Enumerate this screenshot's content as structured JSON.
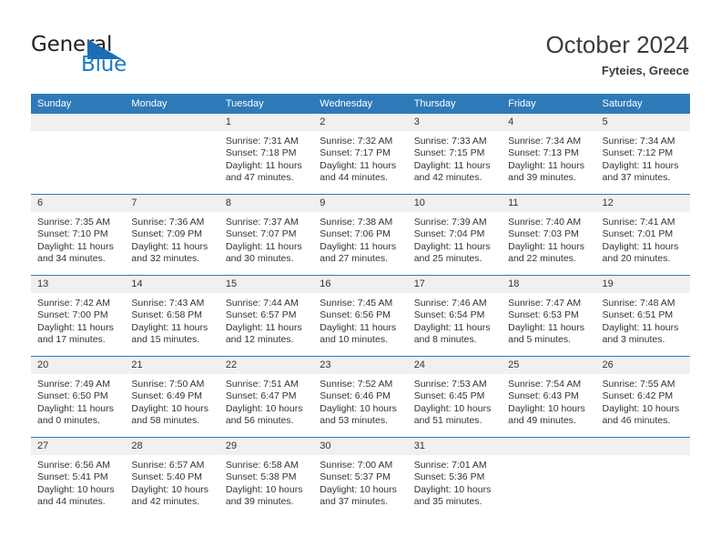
{
  "brand": {
    "name_part1": "General",
    "name_part2": "Blue",
    "logo_icon": "blue-triangle-logo",
    "color_dark": "#231f20",
    "color_blue": "#1b7ac4"
  },
  "header": {
    "title": "October 2024",
    "subtitle": "Fyteies, Greece"
  },
  "theme": {
    "header_row_bg": "#2e7ab8",
    "daynum_bg": "#f0f0f0",
    "grid_line": "#2e7ab8",
    "text": "#333333"
  },
  "calendar": {
    "weekdays": [
      "Sunday",
      "Monday",
      "Tuesday",
      "Wednesday",
      "Thursday",
      "Friday",
      "Saturday"
    ],
    "weeks": [
      [
        {
          "day": "",
          "sunrise": "",
          "sunset": "",
          "daylight_line1": "",
          "daylight_line2": ""
        },
        {
          "day": "",
          "sunrise": "",
          "sunset": "",
          "daylight_line1": "",
          "daylight_line2": ""
        },
        {
          "day": "1",
          "sunrise": "Sunrise: 7:31 AM",
          "sunset": "Sunset: 7:18 PM",
          "daylight_line1": "Daylight: 11 hours",
          "daylight_line2": "and 47 minutes."
        },
        {
          "day": "2",
          "sunrise": "Sunrise: 7:32 AM",
          "sunset": "Sunset: 7:17 PM",
          "daylight_line1": "Daylight: 11 hours",
          "daylight_line2": "and 44 minutes."
        },
        {
          "day": "3",
          "sunrise": "Sunrise: 7:33 AM",
          "sunset": "Sunset: 7:15 PM",
          "daylight_line1": "Daylight: 11 hours",
          "daylight_line2": "and 42 minutes."
        },
        {
          "day": "4",
          "sunrise": "Sunrise: 7:34 AM",
          "sunset": "Sunset: 7:13 PM",
          "daylight_line1": "Daylight: 11 hours",
          "daylight_line2": "and 39 minutes."
        },
        {
          "day": "5",
          "sunrise": "Sunrise: 7:34 AM",
          "sunset": "Sunset: 7:12 PM",
          "daylight_line1": "Daylight: 11 hours",
          "daylight_line2": "and 37 minutes."
        }
      ],
      [
        {
          "day": "6",
          "sunrise": "Sunrise: 7:35 AM",
          "sunset": "Sunset: 7:10 PM",
          "daylight_line1": "Daylight: 11 hours",
          "daylight_line2": "and 34 minutes."
        },
        {
          "day": "7",
          "sunrise": "Sunrise: 7:36 AM",
          "sunset": "Sunset: 7:09 PM",
          "daylight_line1": "Daylight: 11 hours",
          "daylight_line2": "and 32 minutes."
        },
        {
          "day": "8",
          "sunrise": "Sunrise: 7:37 AM",
          "sunset": "Sunset: 7:07 PM",
          "daylight_line1": "Daylight: 11 hours",
          "daylight_line2": "and 30 minutes."
        },
        {
          "day": "9",
          "sunrise": "Sunrise: 7:38 AM",
          "sunset": "Sunset: 7:06 PM",
          "daylight_line1": "Daylight: 11 hours",
          "daylight_line2": "and 27 minutes."
        },
        {
          "day": "10",
          "sunrise": "Sunrise: 7:39 AM",
          "sunset": "Sunset: 7:04 PM",
          "daylight_line1": "Daylight: 11 hours",
          "daylight_line2": "and 25 minutes."
        },
        {
          "day": "11",
          "sunrise": "Sunrise: 7:40 AM",
          "sunset": "Sunset: 7:03 PM",
          "daylight_line1": "Daylight: 11 hours",
          "daylight_line2": "and 22 minutes."
        },
        {
          "day": "12",
          "sunrise": "Sunrise: 7:41 AM",
          "sunset": "Sunset: 7:01 PM",
          "daylight_line1": "Daylight: 11 hours",
          "daylight_line2": "and 20 minutes."
        }
      ],
      [
        {
          "day": "13",
          "sunrise": "Sunrise: 7:42 AM",
          "sunset": "Sunset: 7:00 PM",
          "daylight_line1": "Daylight: 11 hours",
          "daylight_line2": "and 17 minutes."
        },
        {
          "day": "14",
          "sunrise": "Sunrise: 7:43 AM",
          "sunset": "Sunset: 6:58 PM",
          "daylight_line1": "Daylight: 11 hours",
          "daylight_line2": "and 15 minutes."
        },
        {
          "day": "15",
          "sunrise": "Sunrise: 7:44 AM",
          "sunset": "Sunset: 6:57 PM",
          "daylight_line1": "Daylight: 11 hours",
          "daylight_line2": "and 12 minutes."
        },
        {
          "day": "16",
          "sunrise": "Sunrise: 7:45 AM",
          "sunset": "Sunset: 6:56 PM",
          "daylight_line1": "Daylight: 11 hours",
          "daylight_line2": "and 10 minutes."
        },
        {
          "day": "17",
          "sunrise": "Sunrise: 7:46 AM",
          "sunset": "Sunset: 6:54 PM",
          "daylight_line1": "Daylight: 11 hours",
          "daylight_line2": "and 8 minutes."
        },
        {
          "day": "18",
          "sunrise": "Sunrise: 7:47 AM",
          "sunset": "Sunset: 6:53 PM",
          "daylight_line1": "Daylight: 11 hours",
          "daylight_line2": "and 5 minutes."
        },
        {
          "day": "19",
          "sunrise": "Sunrise: 7:48 AM",
          "sunset": "Sunset: 6:51 PM",
          "daylight_line1": "Daylight: 11 hours",
          "daylight_line2": "and 3 minutes."
        }
      ],
      [
        {
          "day": "20",
          "sunrise": "Sunrise: 7:49 AM",
          "sunset": "Sunset: 6:50 PM",
          "daylight_line1": "Daylight: 11 hours",
          "daylight_line2": "and 0 minutes."
        },
        {
          "day": "21",
          "sunrise": "Sunrise: 7:50 AM",
          "sunset": "Sunset: 6:49 PM",
          "daylight_line1": "Daylight: 10 hours",
          "daylight_line2": "and 58 minutes."
        },
        {
          "day": "22",
          "sunrise": "Sunrise: 7:51 AM",
          "sunset": "Sunset: 6:47 PM",
          "daylight_line1": "Daylight: 10 hours",
          "daylight_line2": "and 56 minutes."
        },
        {
          "day": "23",
          "sunrise": "Sunrise: 7:52 AM",
          "sunset": "Sunset: 6:46 PM",
          "daylight_line1": "Daylight: 10 hours",
          "daylight_line2": "and 53 minutes."
        },
        {
          "day": "24",
          "sunrise": "Sunrise: 7:53 AM",
          "sunset": "Sunset: 6:45 PM",
          "daylight_line1": "Daylight: 10 hours",
          "daylight_line2": "and 51 minutes."
        },
        {
          "day": "25",
          "sunrise": "Sunrise: 7:54 AM",
          "sunset": "Sunset: 6:43 PM",
          "daylight_line1": "Daylight: 10 hours",
          "daylight_line2": "and 49 minutes."
        },
        {
          "day": "26",
          "sunrise": "Sunrise: 7:55 AM",
          "sunset": "Sunset: 6:42 PM",
          "daylight_line1": "Daylight: 10 hours",
          "daylight_line2": "and 46 minutes."
        }
      ],
      [
        {
          "day": "27",
          "sunrise": "Sunrise: 6:56 AM",
          "sunset": "Sunset: 5:41 PM",
          "daylight_line1": "Daylight: 10 hours",
          "daylight_line2": "and 44 minutes."
        },
        {
          "day": "28",
          "sunrise": "Sunrise: 6:57 AM",
          "sunset": "Sunset: 5:40 PM",
          "daylight_line1": "Daylight: 10 hours",
          "daylight_line2": "and 42 minutes."
        },
        {
          "day": "29",
          "sunrise": "Sunrise: 6:58 AM",
          "sunset": "Sunset: 5:38 PM",
          "daylight_line1": "Daylight: 10 hours",
          "daylight_line2": "and 39 minutes."
        },
        {
          "day": "30",
          "sunrise": "Sunrise: 7:00 AM",
          "sunset": "Sunset: 5:37 PM",
          "daylight_line1": "Daylight: 10 hours",
          "daylight_line2": "and 37 minutes."
        },
        {
          "day": "31",
          "sunrise": "Sunrise: 7:01 AM",
          "sunset": "Sunset: 5:36 PM",
          "daylight_line1": "Daylight: 10 hours",
          "daylight_line2": "and 35 minutes."
        },
        {
          "day": "",
          "sunrise": "",
          "sunset": "",
          "daylight_line1": "",
          "daylight_line2": ""
        },
        {
          "day": "",
          "sunrise": "",
          "sunset": "",
          "daylight_line1": "",
          "daylight_line2": ""
        }
      ]
    ]
  }
}
